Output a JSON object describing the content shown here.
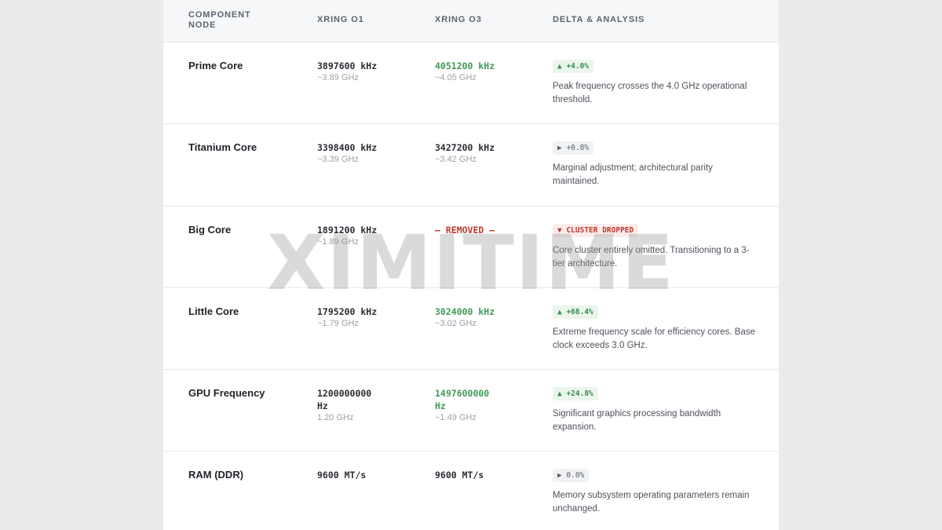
{
  "header": {
    "col_component": "COMPONENT NODE",
    "col_o1": "XRING O1",
    "col_o3": "XRING O3",
    "col_delta": "DELTA & ANALYSIS"
  },
  "rows": [
    {
      "name": "Prime Core",
      "o1_value": "3897600 kHz",
      "o1_sub": "~3.89 GHz",
      "o3_value": "4051200 kHz",
      "o3_sub": "~4.05 GHz",
      "badge": "▲ +4.0%",
      "note": "Peak frequency crosses the 4.0 GHz operational threshold."
    },
    {
      "name": "Titanium Core",
      "o1_value": "3398400 kHz",
      "o1_sub": "~3.39 GHz",
      "o3_value": "3427200 kHz",
      "o3_sub": "~3.42 GHz",
      "badge": "▶ +0.8%",
      "note": "Marginal adjustment; architectural parity maintained."
    },
    {
      "name": "Big Core",
      "o1_value": "1891200 kHz",
      "o1_sub": "~1.89 GHz",
      "o3_value": "— REMOVED —",
      "o3_sub": "",
      "badge": "▼ CLUSTER DROPPED",
      "note": "Core cluster entirely omitted. Transitioning to a 3-tier architecture."
    },
    {
      "name": "Little Core",
      "o1_value": "1795200 kHz",
      "o1_sub": "~1.79 GHz",
      "o3_value": "3024000 kHz",
      "o3_sub": "~3.02 GHz",
      "badge": "▲ +68.4%",
      "note": "Extreme frequency scale for efficiency cores. Base clock exceeds 3.0 GHz."
    },
    {
      "name": "GPU Frequency",
      "o1_value": "1200000000 Hz",
      "o1_sub": "1.20 GHz",
      "o3_value": "1497600000 Hz",
      "o3_sub": "~1.49 GHz",
      "badge": "▲ +24.8%",
      "note": "Significant graphics processing bandwidth expansion."
    },
    {
      "name": "RAM (DDR)",
      "o1_value": "9600 MT/s",
      "o1_sub": "",
      "o3_value": "9600 MT/s",
      "o3_sub": "",
      "badge": "▶ 0.0%",
      "note": "Memory subsystem operating parameters remain unchanged."
    }
  ],
  "watermark": "XIMITIME",
  "colors": {
    "increase": "#3f9a58",
    "removed": "#c0392b",
    "neutral": "#5a606a"
  }
}
